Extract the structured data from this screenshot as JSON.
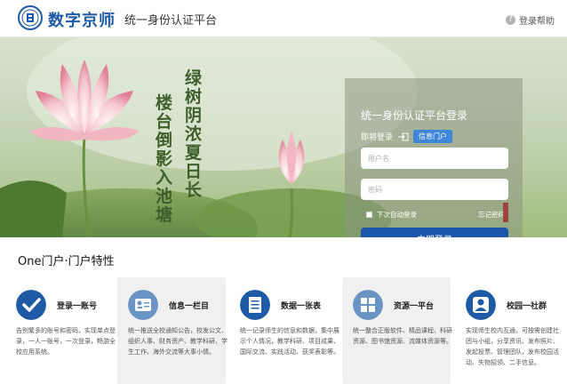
{
  "header": {
    "logo_text": "数字京师",
    "title": "统一身份认证平台",
    "help_label": "登录帮助",
    "help_icon": "help-circle-icon"
  },
  "banner": {
    "poem_line1": "绿树阴浓夏日长",
    "poem_line2": "楼台倒影入池塘"
  },
  "login": {
    "title": "统一身份认证平台登录",
    "login_to_label": "即将登录",
    "portal_tag": "信息门户",
    "username_placeholder": "用户名",
    "password_placeholder": "密码",
    "remember_label": "下次自动登录",
    "forgot_label": "忘记密码",
    "submit_label": "立即登录"
  },
  "features": {
    "title": "One门户·门户特性",
    "items": [
      {
        "name": "登录一账号",
        "desc": "告别繁多的账号和密码，实现单点登录，一人一账号，一次登录，畅游全校应用系统。",
        "icon": "checkmark-icon",
        "color": "#1f5aa6"
      },
      {
        "name": "信息一栏目",
        "desc": "统一推送全校通知公告，校发公文、组织人事、财务资产、教学科研、学生工作、海外交流等大事小情。",
        "icon": "id-card-icon",
        "color": "#6a94c4"
      },
      {
        "name": "数据一张表",
        "desc": "统一记录师生的信息和数据，集中展示个人情况，教学科研、项目成果、国际交流、实践活动、获奖表彰等。",
        "icon": "document-list-icon",
        "color": "#1f5aa6"
      },
      {
        "name": "资源一平台",
        "desc": "统一整合正版软件、精品课程、科研资源、图书馆资源、流媒体资源等。",
        "icon": "grid-apps-icon",
        "color": "#6a94c4"
      },
      {
        "name": "校园一社群",
        "desc": "实现师生校内互通，可按需创建社团与小组，分享资讯、发布照片、发起投票、管理团队，发布校园活动、失物招领、二手信息。",
        "icon": "user-group-icon",
        "color": "#1f5aa6"
      }
    ]
  }
}
